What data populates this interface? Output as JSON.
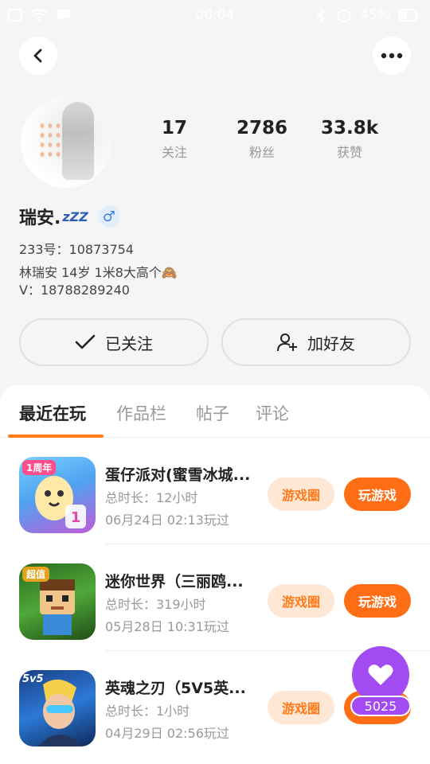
{
  "status_bar": {
    "time": "00:04",
    "battery": "45%"
  },
  "profile": {
    "name": "瑞安.",
    "sleep_mark": "zZZ",
    "gender_symbol": "♂",
    "uid": "233号：10873754",
    "bio_line1": "林瑞安 14岁 1米8大高个🙈",
    "bio_line2": "V：18788289240"
  },
  "stats": [
    {
      "value": "17",
      "label": "关注"
    },
    {
      "value": "2786",
      "label": "粉丝"
    },
    {
      "value": "33.8k",
      "label": "获赞"
    }
  ],
  "actions": {
    "follow": "已关注",
    "add_friend": "加好友"
  },
  "tabs": [
    {
      "label": "最近在玩",
      "active": true
    },
    {
      "label": "作品栏",
      "active": false
    },
    {
      "label": "帖子",
      "active": false
    },
    {
      "label": "评论",
      "active": false
    }
  ],
  "games": [
    {
      "title": "蛋仔派对(蜜雪冰城...",
      "duration": "总时长：12小时",
      "last_played": "06月24日 02:13玩过",
      "circle_label": "游戏圈",
      "play_label": "玩游戏",
      "icon_badge": "1周年"
    },
    {
      "title": "迷你世界（三丽鸥...",
      "duration": "总时长：319小时",
      "last_played": "05月28日 10:31玩过",
      "circle_label": "游戏圈",
      "play_label": "玩游戏",
      "icon_badge": "超值"
    },
    {
      "title": "英魂之刃（5V5英...",
      "duration": "总时长：1小时",
      "last_played": "04月29日 02:56玩过",
      "circle_label": "游戏圈",
      "play_label": "玩游戏",
      "icon_badge": "5v5"
    }
  ],
  "like_fab": {
    "count": "5025"
  },
  "colors": {
    "accent": "#ff6d14",
    "accent_light": "#ffe7d6",
    "purple": "#a24bf2",
    "gender_blue": "#3b82e6"
  }
}
